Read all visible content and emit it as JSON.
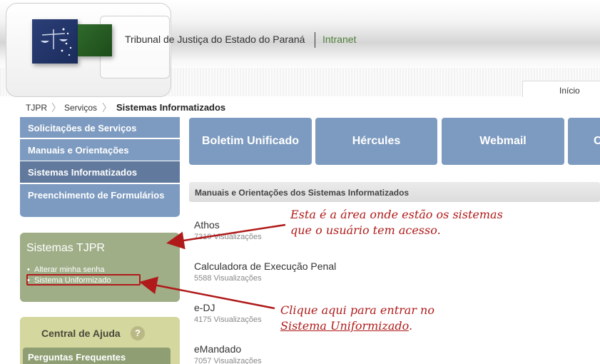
{
  "header": {
    "org_name": "Tribunal de Justiça do Estado do Paraná",
    "intranet_label": "Intranet",
    "nav_inicio": "Início"
  },
  "breadcrumb": {
    "items": [
      "TJPR",
      "Serviços"
    ],
    "current": "Sistemas Informatizados"
  },
  "sidebar": {
    "menu": [
      {
        "label": "Solicitações de Serviços"
      },
      {
        "label": "Manuais e Orientações"
      },
      {
        "label": "Sistemas Informatizados"
      },
      {
        "label": "Preenchimento de Formulários"
      }
    ],
    "sistemas": {
      "title": "Sistemas TJPR",
      "links": [
        "Alterar minha senha",
        "Sistema Uniformizado"
      ]
    },
    "ajuda": {
      "title": "Central de Ajuda",
      "help_icon": "?",
      "faq": "Perguntas Frequentes"
    }
  },
  "tiles": [
    "Boletim Unificado",
    "Hércules",
    "Webmail",
    "C"
  ],
  "section": {
    "title": "Manuais e Orientações dos Sistemas Informatizados",
    "docs": [
      {
        "title": "Athos",
        "views": "7319 Visualizações"
      },
      {
        "title": "Calculadora de Execução Penal",
        "views": "5588 Visualizações"
      },
      {
        "title": "e-DJ",
        "views": "4175 Visualizações"
      },
      {
        "title": "eMandado",
        "views": "7057 Visualizações"
      }
    ]
  },
  "annotations": {
    "note_1": "Esta é a área onde estão os sistemas que o usuário tem acesso.",
    "note_2_prefix": "Clique aqui para entrar no",
    "note_2_link": "Sistema Uniformizado",
    "note_2_suffix": "."
  },
  "colors": {
    "menu_blue": "#7d9bc0",
    "menu_active": "#61799d",
    "sistemas_green": "#9fae87",
    "ajuda_yellow": "#d4d79e",
    "annotation_red": "#b01a1a",
    "intranet_green": "#4f7f3a"
  }
}
